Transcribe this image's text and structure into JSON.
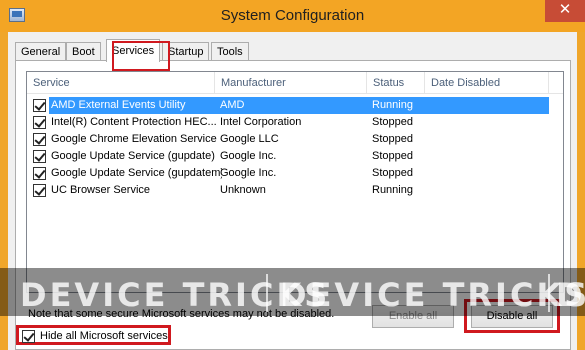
{
  "window": {
    "title": "System Configuration",
    "close_glyph": "✕"
  },
  "tabs": [
    {
      "label": "General"
    },
    {
      "label": "Boot"
    },
    {
      "label": "Services",
      "active": true
    },
    {
      "label": "Startup"
    },
    {
      "label": "Tools"
    }
  ],
  "table": {
    "columns": [
      "Service",
      "Manufacturer",
      "Status",
      "Date Disabled"
    ],
    "rows": [
      {
        "service": "AMD External Events Utility",
        "manufacturer": "AMD",
        "status": "Running",
        "date_disabled": "",
        "checked": true,
        "selected": true
      },
      {
        "service": "Intel(R) Content Protection HEC...",
        "manufacturer": "Intel Corporation",
        "status": "Stopped",
        "date_disabled": "",
        "checked": true
      },
      {
        "service": "Google Chrome Elevation Service",
        "manufacturer": "Google LLC",
        "status": "Stopped",
        "date_disabled": "",
        "checked": true
      },
      {
        "service": "Google Update Service (gupdate)",
        "manufacturer": "Google Inc.",
        "status": "Stopped",
        "date_disabled": "",
        "checked": true
      },
      {
        "service": "Google Update Service (gupdatem)",
        "manufacturer": "Google Inc.",
        "status": "Stopped",
        "date_disabled": "",
        "checked": true
      },
      {
        "service": "UC Browser Service",
        "manufacturer": "Unknown",
        "status": "Running",
        "date_disabled": "",
        "checked": true
      }
    ]
  },
  "note": "Note that some secure Microsoft services may not be disabled.",
  "buttons": {
    "enable_all": "Enable all",
    "disable_all": "Disable all"
  },
  "hide_ms": {
    "label": "Hide all Microsoft services",
    "checked": true
  },
  "watermark": {
    "text_1": "DEVICE TRICKS",
    "text_2": "DEVICE TRICKS",
    "text_3": "DEVI"
  },
  "colors": {
    "title_bar": "#f3a524",
    "selection": "#3399ff",
    "highlight_box": "#d0191f"
  }
}
